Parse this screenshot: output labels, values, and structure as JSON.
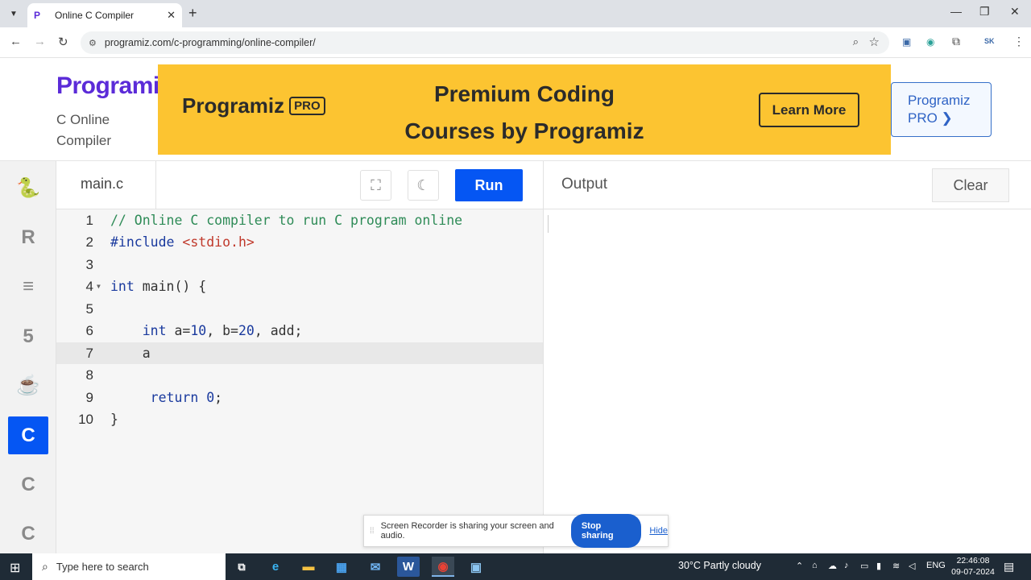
{
  "browser": {
    "tab_title": "Online C Compiler",
    "tab_close": "✕",
    "new_tab": "+",
    "url": "programiz.com/c-programming/online-compiler/"
  },
  "header": {
    "logo": "Programiz",
    "subtitle": "C Online Compiler",
    "banner": {
      "pro_logo": "Programiz",
      "pro_badge": "PRO",
      "headline_line1": "Premium Coding",
      "headline_line2": "Courses by Programiz",
      "learn_more": "Learn More",
      "accent_color": "#fcc431"
    },
    "pro_button": "Programiz PRO ❯"
  },
  "sidebar": {
    "items": [
      {
        "name": "python",
        "glyph": "🐍"
      },
      {
        "name": "r",
        "glyph": "R"
      },
      {
        "name": "sql",
        "glyph": "≡"
      },
      {
        "name": "html5",
        "glyph": "5"
      },
      {
        "name": "java",
        "glyph": "☕"
      },
      {
        "name": "c",
        "glyph": "C",
        "active": true
      },
      {
        "name": "cpp",
        "glyph": "C"
      },
      {
        "name": "csharp",
        "glyph": "C"
      }
    ]
  },
  "editor": {
    "filename": "main.c",
    "run_label": "Run",
    "run_color": "#0556f3",
    "current_line": 7,
    "lines": [
      {
        "num": "1",
        "text": "// Online C compiler to run C program online"
      },
      {
        "num": "2",
        "text": "#include <stdio.h>"
      },
      {
        "num": "3",
        "text": ""
      },
      {
        "num": "4",
        "text": "int main() {"
      },
      {
        "num": "5",
        "text": ""
      },
      {
        "num": "6",
        "text": "    int a=10, b=20, add;"
      },
      {
        "num": "7",
        "text": "    a"
      },
      {
        "num": "8",
        "text": ""
      },
      {
        "num": "9",
        "text": "     return 0;"
      },
      {
        "num": "10",
        "text": "}"
      }
    ]
  },
  "output": {
    "title": "Output",
    "clear_label": "Clear"
  },
  "recorder": {
    "message": "Screen Recorder is sharing your screen and audio.",
    "stop_label": "Stop sharing",
    "hide_label": "Hide"
  },
  "taskbar": {
    "search_placeholder": "Type here to search",
    "weather": "30°C  Partly cloudy",
    "language": "ENG",
    "time": "22:46:08",
    "date": "09-07-2024"
  }
}
